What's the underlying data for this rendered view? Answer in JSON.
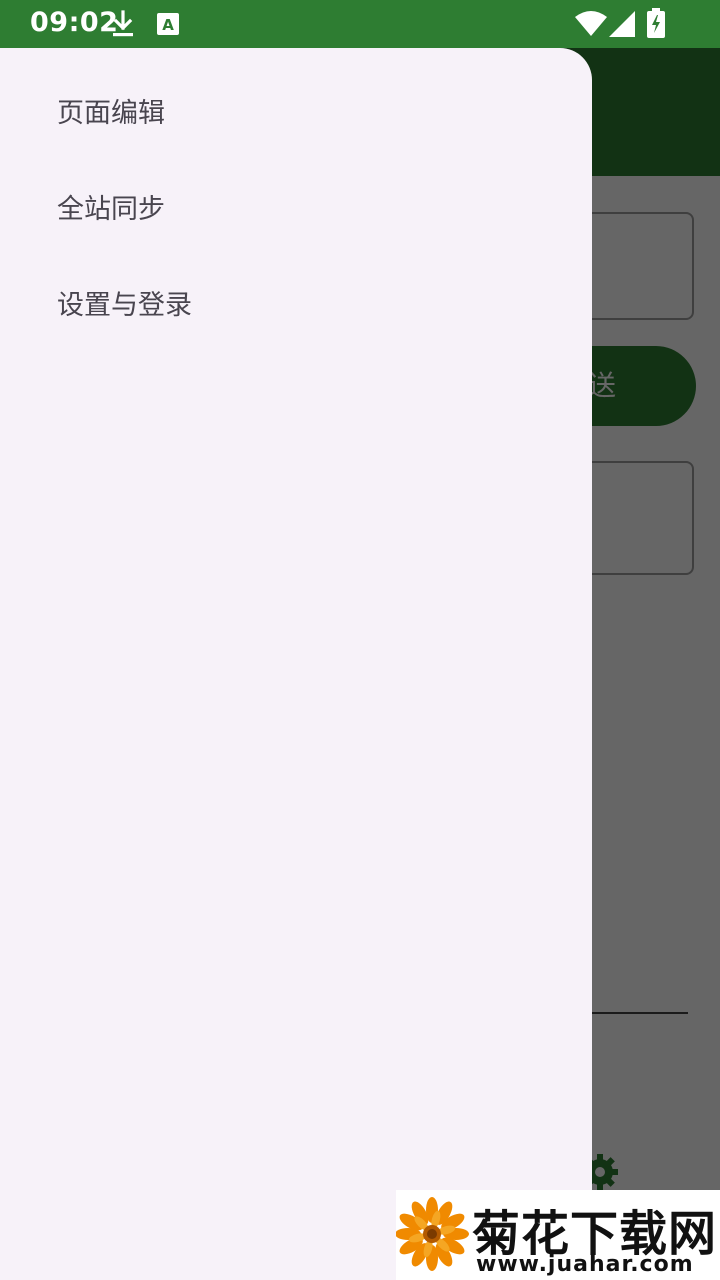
{
  "status_bar": {
    "time": "09:02",
    "icons": [
      "download-icon",
      "keyboard-a-icon",
      "wifi-icon",
      "cell-signal-icon",
      "battery-charging-icon"
    ],
    "background": "#2e7d32"
  },
  "app": {
    "toolbar_color": "#2e7d32",
    "send_button_label": "送",
    "settings_icon": "gear-icon"
  },
  "drawer": {
    "background": "#f7f2f9",
    "items": [
      {
        "label": "页面编辑"
      },
      {
        "label": "全站同步"
      },
      {
        "label": "设置与登录"
      }
    ]
  },
  "watermark": {
    "title": "菊花下载网",
    "url": "www.juahar.com",
    "logo_icon": "flower-icon"
  }
}
